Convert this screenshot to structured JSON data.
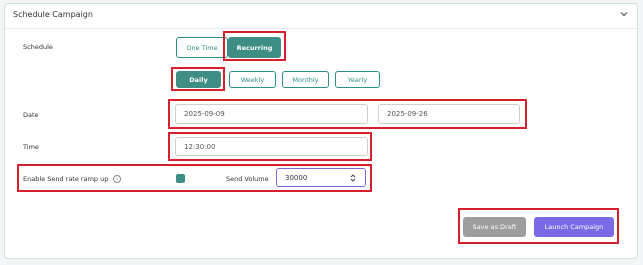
{
  "panel": {
    "title": "Schedule Campaign"
  },
  "schedule": {
    "label": "Schedule",
    "mode_options": [
      "One Time",
      "Recurring"
    ],
    "frequency_options": [
      "Daily",
      "Weekly",
      "Monthly",
      "Yearly"
    ]
  },
  "date": {
    "label": "Date",
    "start": "2025-09-09",
    "end": "2025-09-26"
  },
  "time": {
    "label": "Time",
    "value": "12:30:00"
  },
  "ramp": {
    "label": "Enable Send rate ramp up",
    "info": "i",
    "send_volume_label": "Send Volume",
    "send_volume": "30000"
  },
  "actions": {
    "save": "Save as Draft",
    "launch": "Launch Campaign"
  },
  "colors": {
    "accent": "#3f8e86",
    "highlight": "#d6202e",
    "launch": "#7b6ae6",
    "save": "#9e9e9e"
  }
}
